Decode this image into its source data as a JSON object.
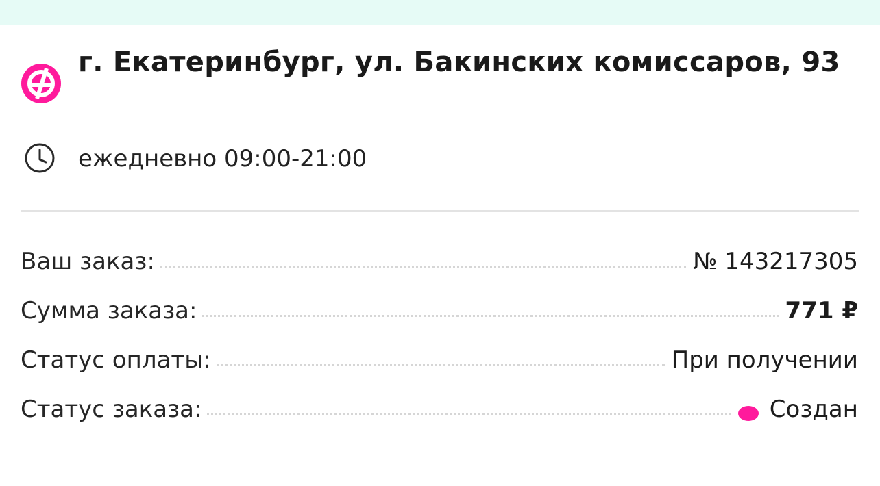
{
  "colors": {
    "brand": "#ff1a9c",
    "banner": "#e6fbf6",
    "divider": "#e3e3e3"
  },
  "pickup": {
    "brand_icon": "brand-logo-icon",
    "address": "г. Екатеринбург, ул. Бакинских комиссаров, 93",
    "hours_icon": "clock-icon",
    "hours": "ежедневно 09:00-21:00"
  },
  "order": {
    "rows": [
      {
        "label": "Ваш заказ:",
        "value": "№ 143217305"
      },
      {
        "label": "Сумма заказа:",
        "value": "771 ₽"
      },
      {
        "label": "Статус оплаты:",
        "value": "При получении"
      },
      {
        "label": "Статус заказа:",
        "value": "Создан"
      }
    ]
  }
}
